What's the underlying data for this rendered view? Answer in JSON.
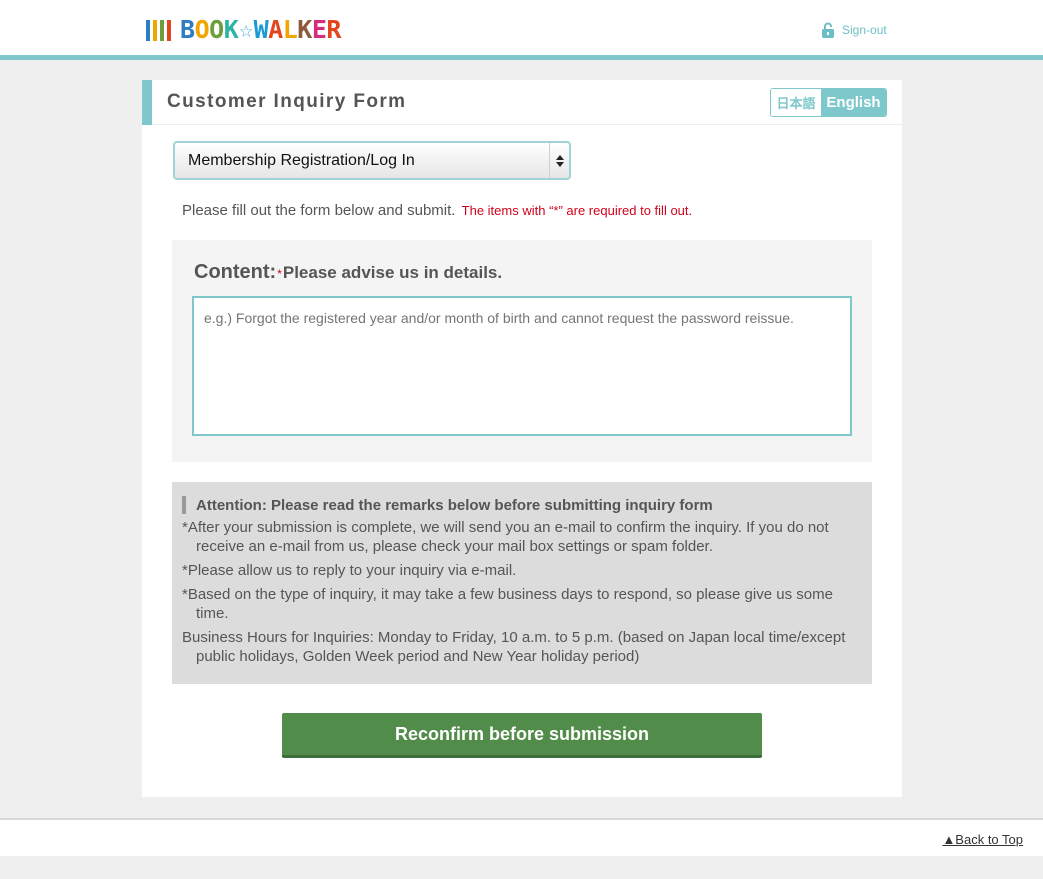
{
  "header": {
    "logo_letters": [
      {
        "char": "B",
        "color": "#2e7cc2"
      },
      {
        "char": "O",
        "color": "#f1a500"
      },
      {
        "char": "O",
        "color": "#6c9e3c"
      },
      {
        "char": "K",
        "color": "#2bb3a6"
      },
      {
        "char": "☆",
        "color": "#4aa8d8"
      },
      {
        "char": "W",
        "color": "#1a9bd8"
      },
      {
        "char": "A",
        "color": "#e3451f"
      },
      {
        "char": "L",
        "color": "#f1a500"
      },
      {
        "char": "K",
        "color": "#8a5a3a"
      },
      {
        "char": "E",
        "color": "#d62a7b"
      },
      {
        "char": "R",
        "color": "#e3451f"
      }
    ],
    "logo_stripe_colors": [
      "#2e7cc2",
      "#f1a500",
      "#6c9e3c",
      "#e3451f"
    ],
    "signout_label": "Sign-out"
  },
  "form": {
    "title": "Customer Inquiry Form",
    "lang_ja": "日本語",
    "lang_en": "English",
    "category_selected": "Membership Registration/Log In",
    "instructions": "Please fill out the form below and submit.",
    "required_note": "The items with “*” are required to fill out.",
    "content_label": "Content:",
    "content_required_mark": "*",
    "content_sublabel": "Please advise us in details.",
    "content_placeholder": "e.g.) Forgot the registered year and/or month of birth and cannot request the password reissue.",
    "content_value": ""
  },
  "attention": {
    "title": "Attention: Please read the remarks below before submitting inquiry form",
    "items": [
      "*After your submission is complete, we will send you an e-mail to confirm the inquiry. If you do not receive an e-mail from us, please check your mail box settings or spam folder.",
      "*Please allow us to reply to your inquiry via e-mail.",
      "*Based on the type of inquiry, it may take a few business days to respond, so please give us some time.",
      "Business Hours for Inquiries: Monday to Friday, 10 a.m. to 5 p.m. (based on Japan local time/except public holidays, Golden Week period and New Year holiday period)"
    ]
  },
  "submit_label": "Reconfirm before submission",
  "footer": {
    "back_to_top": "▲Back to Top"
  },
  "colors": {
    "accent_teal": "#7ec8cc",
    "submit_green": "#528c4b",
    "required_red": "#d0021b"
  }
}
